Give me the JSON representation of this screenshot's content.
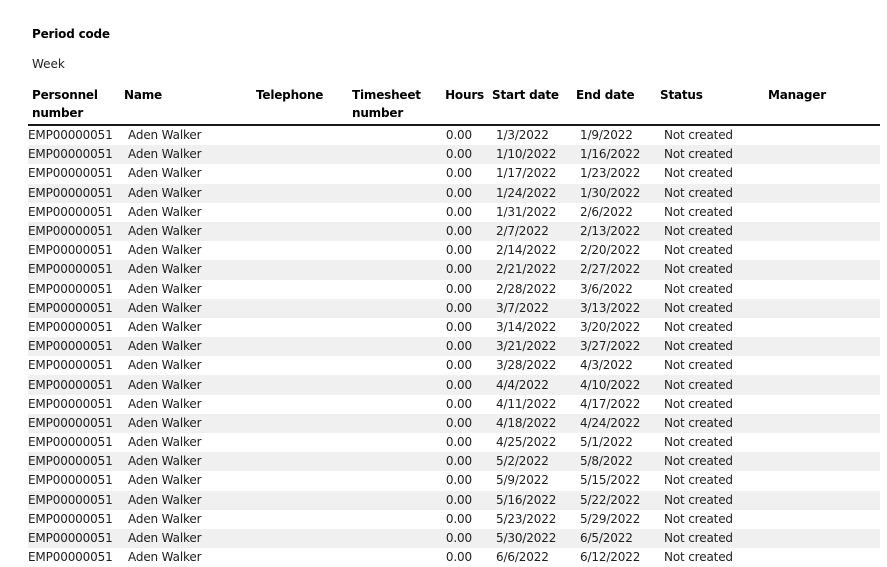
{
  "filter": {
    "label": "Period code",
    "value": "Week"
  },
  "table": {
    "columns": [
      {
        "key": "personnel_number",
        "label": "Personnel number"
      },
      {
        "key": "name",
        "label": "Name"
      },
      {
        "key": "telephone",
        "label": "Telephone"
      },
      {
        "key": "timesheet_number",
        "label": "Timesheet number"
      },
      {
        "key": "hours",
        "label": "Hours"
      },
      {
        "key": "start_date",
        "label": "Start date"
      },
      {
        "key": "end_date",
        "label": "End date"
      },
      {
        "key": "status",
        "label": "Status"
      },
      {
        "key": "manager",
        "label": "Manager"
      }
    ],
    "rows": [
      {
        "personnel_number": "EMP00000051",
        "name": "Aden Walker",
        "telephone": "",
        "timesheet_number": "",
        "hours": "0.00",
        "start_date": "1/3/2022",
        "end_date": "1/9/2022",
        "status": "Not created",
        "manager": ""
      },
      {
        "personnel_number": "EMP00000051",
        "name": "Aden Walker",
        "telephone": "",
        "timesheet_number": "",
        "hours": "0.00",
        "start_date": "1/10/2022",
        "end_date": "1/16/2022",
        "status": "Not created",
        "manager": ""
      },
      {
        "personnel_number": "EMP00000051",
        "name": "Aden Walker",
        "telephone": "",
        "timesheet_number": "",
        "hours": "0.00",
        "start_date": "1/17/2022",
        "end_date": "1/23/2022",
        "status": "Not created",
        "manager": ""
      },
      {
        "personnel_number": "EMP00000051",
        "name": "Aden Walker",
        "telephone": "",
        "timesheet_number": "",
        "hours": "0.00",
        "start_date": "1/24/2022",
        "end_date": "1/30/2022",
        "status": "Not created",
        "manager": ""
      },
      {
        "personnel_number": "EMP00000051",
        "name": "Aden Walker",
        "telephone": "",
        "timesheet_number": "",
        "hours": "0.00",
        "start_date": "1/31/2022",
        "end_date": "2/6/2022",
        "status": "Not created",
        "manager": ""
      },
      {
        "personnel_number": "EMP00000051",
        "name": "Aden Walker",
        "telephone": "",
        "timesheet_number": "",
        "hours": "0.00",
        "start_date": "2/7/2022",
        "end_date": "2/13/2022",
        "status": "Not created",
        "manager": ""
      },
      {
        "personnel_number": "EMP00000051",
        "name": "Aden Walker",
        "telephone": "",
        "timesheet_number": "",
        "hours": "0.00",
        "start_date": "2/14/2022",
        "end_date": "2/20/2022",
        "status": "Not created",
        "manager": ""
      },
      {
        "personnel_number": "EMP00000051",
        "name": "Aden Walker",
        "telephone": "",
        "timesheet_number": "",
        "hours": "0.00",
        "start_date": "2/21/2022",
        "end_date": "2/27/2022",
        "status": "Not created",
        "manager": ""
      },
      {
        "personnel_number": "EMP00000051",
        "name": "Aden Walker",
        "telephone": "",
        "timesheet_number": "",
        "hours": "0.00",
        "start_date": "2/28/2022",
        "end_date": "3/6/2022",
        "status": "Not created",
        "manager": ""
      },
      {
        "personnel_number": "EMP00000051",
        "name": "Aden Walker",
        "telephone": "",
        "timesheet_number": "",
        "hours": "0.00",
        "start_date": "3/7/2022",
        "end_date": "3/13/2022",
        "status": "Not created",
        "manager": ""
      },
      {
        "personnel_number": "EMP00000051",
        "name": "Aden Walker",
        "telephone": "",
        "timesheet_number": "",
        "hours": "0.00",
        "start_date": "3/14/2022",
        "end_date": "3/20/2022",
        "status": "Not created",
        "manager": ""
      },
      {
        "personnel_number": "EMP00000051",
        "name": "Aden Walker",
        "telephone": "",
        "timesheet_number": "",
        "hours": "0.00",
        "start_date": "3/21/2022",
        "end_date": "3/27/2022",
        "status": "Not created",
        "manager": ""
      },
      {
        "personnel_number": "EMP00000051",
        "name": "Aden Walker",
        "telephone": "",
        "timesheet_number": "",
        "hours": "0.00",
        "start_date": "3/28/2022",
        "end_date": "4/3/2022",
        "status": "Not created",
        "manager": ""
      },
      {
        "personnel_number": "EMP00000051",
        "name": "Aden Walker",
        "telephone": "",
        "timesheet_number": "",
        "hours": "0.00",
        "start_date": "4/4/2022",
        "end_date": "4/10/2022",
        "status": "Not created",
        "manager": ""
      },
      {
        "personnel_number": "EMP00000051",
        "name": "Aden Walker",
        "telephone": "",
        "timesheet_number": "",
        "hours": "0.00",
        "start_date": "4/11/2022",
        "end_date": "4/17/2022",
        "status": "Not created",
        "manager": ""
      },
      {
        "personnel_number": "EMP00000051",
        "name": "Aden Walker",
        "telephone": "",
        "timesheet_number": "",
        "hours": "0.00",
        "start_date": "4/18/2022",
        "end_date": "4/24/2022",
        "status": "Not created",
        "manager": ""
      },
      {
        "personnel_number": "EMP00000051",
        "name": "Aden Walker",
        "telephone": "",
        "timesheet_number": "",
        "hours": "0.00",
        "start_date": "4/25/2022",
        "end_date": "5/1/2022",
        "status": "Not created",
        "manager": ""
      },
      {
        "personnel_number": "EMP00000051",
        "name": "Aden Walker",
        "telephone": "",
        "timesheet_number": "",
        "hours": "0.00",
        "start_date": "5/2/2022",
        "end_date": "5/8/2022",
        "status": "Not created",
        "manager": ""
      },
      {
        "personnel_number": "EMP00000051",
        "name": "Aden Walker",
        "telephone": "",
        "timesheet_number": "",
        "hours": "0.00",
        "start_date": "5/9/2022",
        "end_date": "5/15/2022",
        "status": "Not created",
        "manager": ""
      },
      {
        "personnel_number": "EMP00000051",
        "name": "Aden Walker",
        "telephone": "",
        "timesheet_number": "",
        "hours": "0.00",
        "start_date": "5/16/2022",
        "end_date": "5/22/2022",
        "status": "Not created",
        "manager": ""
      },
      {
        "personnel_number": "EMP00000051",
        "name": "Aden Walker",
        "telephone": "",
        "timesheet_number": "",
        "hours": "0.00",
        "start_date": "5/23/2022",
        "end_date": "5/29/2022",
        "status": "Not created",
        "manager": ""
      },
      {
        "personnel_number": "EMP00000051",
        "name": "Aden Walker",
        "telephone": "",
        "timesheet_number": "",
        "hours": "0.00",
        "start_date": "5/30/2022",
        "end_date": "6/5/2022",
        "status": "Not created",
        "manager": ""
      },
      {
        "personnel_number": "EMP00000051",
        "name": "Aden Walker",
        "telephone": "",
        "timesheet_number": "",
        "hours": "0.00",
        "start_date": "6/6/2022",
        "end_date": "6/12/2022",
        "status": "Not created",
        "manager": ""
      }
    ]
  }
}
